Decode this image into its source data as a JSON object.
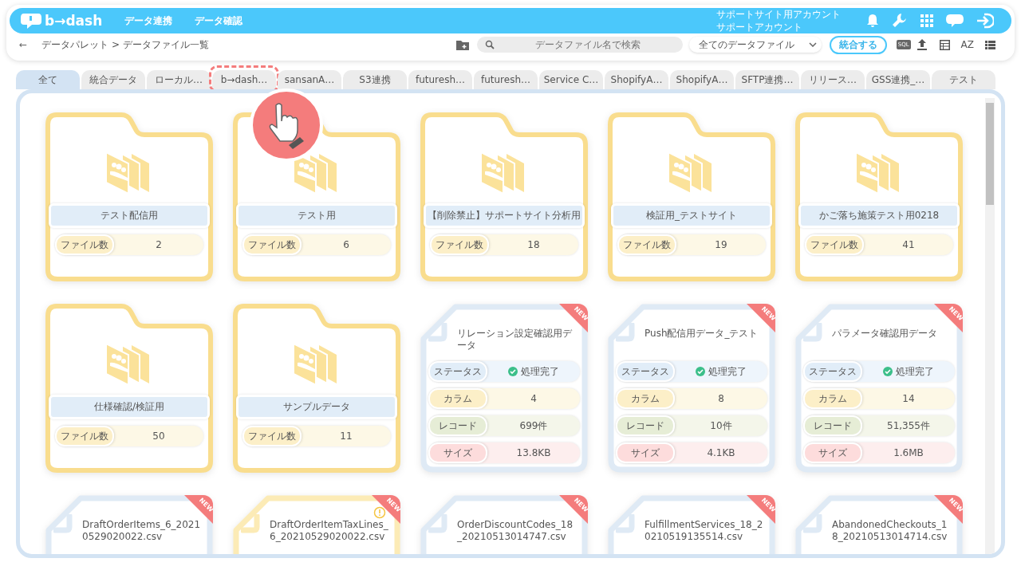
{
  "header": {
    "logo": "b→dash",
    "nav": [
      "データ連携",
      "データ確認"
    ],
    "account": [
      "サポートサイト用アカウント",
      "サポートアカウント"
    ]
  },
  "breadcrumb": {
    "back": "←",
    "path": "データパレット > データファイル一覧"
  },
  "toolbar": {
    "search": {
      "placeholder": "データファイル名で検索"
    },
    "filter": "全てのデータファイル",
    "merge_button": "統合する",
    "sql_badge": "SQL",
    "sort_label": "AZ"
  },
  "tabs": [
    {
      "label": "全て",
      "selected": true,
      "highlighted": false
    },
    {
      "label": "統合データ",
      "selected": false,
      "highlighted": false
    },
    {
      "label": "ローカル…",
      "selected": false,
      "highlighted": false
    },
    {
      "label": "b→dash…",
      "selected": false,
      "highlighted": true
    },
    {
      "label": "sansanA…",
      "selected": false,
      "highlighted": false
    },
    {
      "label": "S3連携",
      "selected": false,
      "highlighted": false
    },
    {
      "label": "futuresh…",
      "selected": false,
      "highlighted": false
    },
    {
      "label": "futuresh…",
      "selected": false,
      "highlighted": false
    },
    {
      "label": "Service C…",
      "selected": false,
      "highlighted": false
    },
    {
      "label": "ShopifyA…",
      "selected": false,
      "highlighted": false
    },
    {
      "label": "ShopifyA…",
      "selected": false,
      "highlighted": false
    },
    {
      "label": "SFTP連携…",
      "selected": false,
      "highlighted": false
    },
    {
      "label": "リリース…",
      "selected": false,
      "highlighted": false
    },
    {
      "label": "GSS連携_…",
      "selected": false,
      "highlighted": false
    },
    {
      "label": "テスト",
      "selected": false,
      "highlighted": false
    }
  ],
  "items": [
    {
      "kind": "folder",
      "name": "テスト配信用",
      "count_label": "ファイル数",
      "count": "2"
    },
    {
      "kind": "folder",
      "name": "テスト用",
      "count_label": "ファイル数",
      "count": "6"
    },
    {
      "kind": "folder",
      "name": "【削除禁止】サポートサイト分析用",
      "count_label": "ファイル数",
      "count": "18"
    },
    {
      "kind": "folder",
      "name": "検証用_テストサイト",
      "count_label": "ファイル数",
      "count": "19"
    },
    {
      "kind": "folder",
      "name": "かご落ち施策テスト用0218",
      "count_label": "ファイル数",
      "count": "41"
    },
    {
      "kind": "folder",
      "name": "仕様確認/検証用",
      "count_label": "ファイル数",
      "count": "50"
    },
    {
      "kind": "folder",
      "name": "サンプルデータ",
      "count_label": "ファイル数",
      "count": "11"
    },
    {
      "kind": "file",
      "title": "リレーション設定確認用データ",
      "badge": "NEW",
      "warning": false,
      "stats": [
        {
          "kind": "status",
          "label": "ステータス",
          "value": "処理完了"
        },
        {
          "kind": "column",
          "label": "カラム",
          "value": "4"
        },
        {
          "kind": "record",
          "label": "レコード",
          "value": "699件"
        },
        {
          "kind": "size",
          "label": "サイズ",
          "value": "13.8KB"
        }
      ]
    },
    {
      "kind": "file",
      "title": "Push配信用データ_テスト",
      "badge": "NEW",
      "warning": false,
      "stats": [
        {
          "kind": "status",
          "label": "ステータス",
          "value": "処理完了"
        },
        {
          "kind": "column",
          "label": "カラム",
          "value": "8"
        },
        {
          "kind": "record",
          "label": "レコード",
          "value": "10件"
        },
        {
          "kind": "size",
          "label": "サイズ",
          "value": "4.1KB"
        }
      ]
    },
    {
      "kind": "file",
      "title": "パラメータ確認用データ",
      "badge": "NEW",
      "warning": false,
      "stats": [
        {
          "kind": "status",
          "label": "ステータス",
          "value": "処理完了"
        },
        {
          "kind": "column",
          "label": "カラム",
          "value": "14"
        },
        {
          "kind": "record",
          "label": "レコード",
          "value": "51,355件"
        },
        {
          "kind": "size",
          "label": "サイズ",
          "value": "1.6MB"
        }
      ]
    },
    {
      "kind": "file",
      "title": "DraftOrderItems_6_20210529020022.csv",
      "badge": "NEW",
      "warning": false
    },
    {
      "kind": "file",
      "title": "DraftOrderItemTaxLines_6_20210529020022.csv",
      "badge": "NEW",
      "warning": true
    },
    {
      "kind": "file",
      "title": "OrderDiscountCodes_18_20210513014747.csv",
      "badge": "NEW",
      "warning": false
    },
    {
      "kind": "file",
      "title": "FulfillmentServices_18_20210519135514.csv",
      "badge": "NEW",
      "warning": false
    },
    {
      "kind": "file",
      "title": "AbandonedCheckouts_18_20210513014714.csv",
      "badge": "NEW",
      "warning": false
    }
  ]
}
